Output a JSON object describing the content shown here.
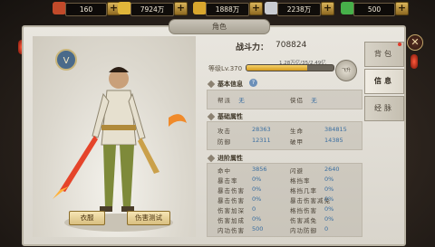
{
  "top_bar": {
    "resources": [
      {
        "name": "ingot",
        "icon": "red-ingot-icon",
        "value": "160",
        "color": "#c24a2a"
      },
      {
        "name": "gold",
        "icon": "gold-ingot-icon",
        "value": "7924万",
        "color": "#e0b63a"
      },
      {
        "name": "gold-bound",
        "icon": "gold-pile-icon",
        "value": "1888万",
        "color": "#d9a72e"
      },
      {
        "name": "silver",
        "icon": "silver-ingot-icon",
        "value": "2238万",
        "color": "#c9ccd2"
      },
      {
        "name": "jade",
        "icon": "green-jade-icon",
        "value": "500",
        "color": "#47b04a"
      }
    ],
    "plus_label": "+"
  },
  "window": {
    "title": "角色",
    "close_label": "✕",
    "tabs": [
      {
        "label": "背包",
        "active": false
      },
      {
        "label": "信息",
        "active": true
      },
      {
        "label": "经脉",
        "active": false
      }
    ]
  },
  "character": {
    "emblem_text": "V",
    "buttons": {
      "fashion": "衣服",
      "damage_test": "伤害测试"
    }
  },
  "summary": {
    "power_label": "战斗力：",
    "power_value": "708824",
    "level": "等级Lv.370",
    "exp_text": "1.28万亿/35/2.49亿",
    "exp_fraction": 0.7,
    "level_btn": "飞升"
  },
  "basic_info": {
    "title": "基本信息",
    "help": "?",
    "rows": [
      {
        "label": "帮派",
        "value": "无"
      },
      {
        "label": "侠侣",
        "value": "无"
      }
    ]
  },
  "base_attrs": {
    "title": "基础属性",
    "rows": [
      {
        "l1": "攻击",
        "v1": "28363",
        "l2": "生命",
        "v2": "384815"
      },
      {
        "l1": "防御",
        "v1": "12311",
        "l2": "破甲",
        "v2": "14385"
      }
    ]
  },
  "adv_attrs": {
    "title": "进阶属性",
    "rows": [
      {
        "l1": "命中",
        "v1": "3856",
        "l2": "闪避",
        "v2": "2640"
      },
      {
        "l1": "暴击率",
        "v1": "0%",
        "l2": "格挡率",
        "v2": "0%"
      },
      {
        "l1": "暴击伤害",
        "v1": "0%",
        "l2": "格挡几率",
        "v2": "0%"
      },
      {
        "l1": "暴击伤害",
        "v1": "0%",
        "l2": "暴击伤害减免",
        "v2": "0%"
      },
      {
        "l1": "伤害加深",
        "v1": "0",
        "l2": "格挡伤害",
        "v2": "0%"
      },
      {
        "l1": "伤害加成",
        "v1": "0%",
        "l2": "伤害减免",
        "v2": "0%"
      },
      {
        "l1": "内功伤害",
        "v1": "500",
        "l2": "内功防御",
        "v2": "0"
      }
    ]
  }
}
